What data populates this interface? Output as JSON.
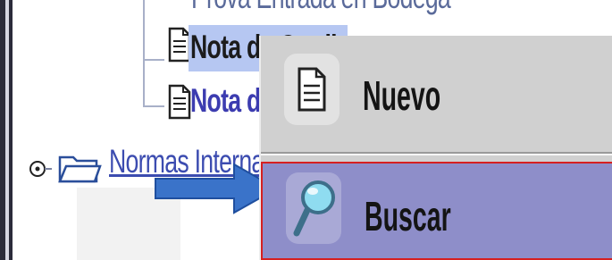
{
  "tree": {
    "top_partial_label": "Prova Entrada en Bodega",
    "items": [
      {
        "label": "Nota de Credito"
      },
      {
        "label": "Nota de Debito"
      }
    ],
    "folder_label": "Normas Internas"
  },
  "context_menu": {
    "items": [
      {
        "label": "Nuevo",
        "icon": "document-icon"
      },
      {
        "label": "Buscar",
        "icon": "magnifier-icon"
      }
    ]
  },
  "colors": {
    "selection": "#b6c7f2",
    "menu_bg": "#d0d0d0",
    "menu_hover": "#8e8ec9",
    "highlight_border": "#d62020",
    "arrow": "#3a73c9"
  }
}
